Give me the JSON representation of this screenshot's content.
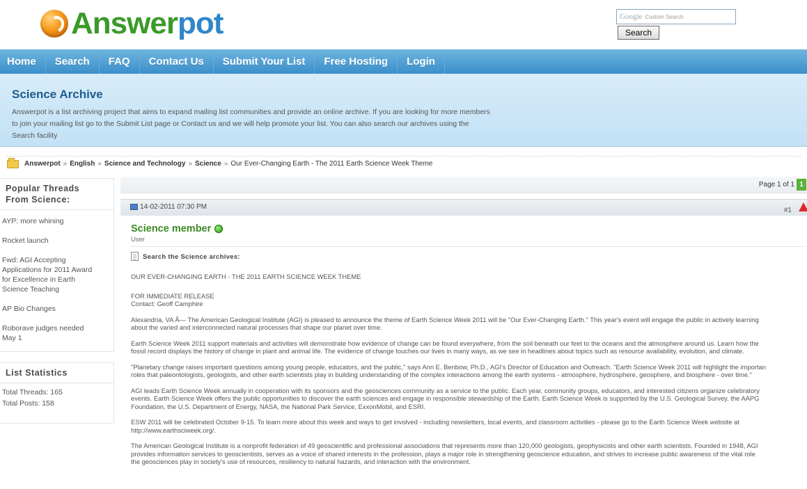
{
  "header": {
    "logo_part1": "Answer",
    "logo_part2": "pot",
    "search_brand": "Google",
    "search_placeholder": "Custom Search",
    "search_button": "Search"
  },
  "nav": [
    "Home",
    "Search",
    "FAQ",
    "Contact Us",
    "Submit Your List",
    "Free Hosting",
    "Login"
  ],
  "archive": {
    "title": "Science Archive",
    "description": "Answerpot is a list archiving project that aims to expand mailing list communities and provide an online archive. If you are looking for more members to join your mailing list go to the Submit List page or Contact us and we will help promote your list. You can also search our archives using the Search facility"
  },
  "breadcrumb": {
    "items": [
      "Answerpot",
      "English",
      "Science and Technology",
      "Science"
    ],
    "current": "Our Ever-Changing Earth - The 2011 Earth Science Week Theme",
    "separator": "»"
  },
  "sidebar": {
    "threads_title_line1": "Popular Threads",
    "threads_title_line2": "From Science:",
    "threads": [
      [
        "AYP: more whining"
      ],
      [
        "Rocket launch"
      ],
      [
        "Fwd: AGI Accepting",
        "Applications for 2011 Award",
        "for Excellence in Earth",
        "Science Teaching"
      ],
      [
        "AP Bio Changes"
      ],
      [
        "Roborave judges needed",
        "May 1"
      ]
    ],
    "stats_title": "List Statistics",
    "stats": [
      "Total Threads: 165",
      "Total Posts: 158"
    ]
  },
  "pagination": {
    "label": "Page 1 of 1",
    "current": "1"
  },
  "post": {
    "date": "14-02-2011 07:30 PM",
    "number": "#1",
    "author": "Science member",
    "role": "User",
    "search_label": "Search the Science archives:",
    "lines": [
      [
        "OUR EVER-CHANGING EARTH - THE 2011 EARTH SCIENCE WEEK THEME"
      ],
      [
        "FOR IMMEDIATE RELEASE",
        "Contact: Geoff Camphire"
      ],
      [
        "Alexandria, VA Â— The American Geological Institute (AGI) is pleased to announce the theme of Earth Science Week 2011 will be \"Our Ever-Changing Earth.\" This year's event will engage the public in actively learning",
        "about the varied and interconnected natural processes that shape our planet over time."
      ],
      [
        "Earth Science Week 2011 support materials and activities will demonstrate how evidence of change can be found everywhere, from the soil beneath our feet to the oceans and the atmosphere around us. Learn how the",
        "fossil record displays the history of change in plant and animal life. The evidence of change touches our lives in many ways, as we see in headlines about topics such as resource availability, evolution, and climate."
      ],
      [
        "\"Planetary change raises important questions among young people, educators, and the public,\" says Ann E. Benbow, Ph.D., AGI's Director of Education and Outreach. \"Earth Science Week 2011 will highlight the importan",
        "roles that paleontologists, geologists, and other earth scientists play in building understanding of the complex interactions among the earth systems - atmosphere, hydrosphere, geosphere, and biosphere - over time.\""
      ],
      [
        "AGI leads Earth Science Week annually in cooperation with its sponsors and the geosciences community as a service to the public. Each year, community groups, educators, and interested citizens organize celebratory",
        "events. Earth Science Week offers the public opportunities to discover the earth sciences and engage in responsible stewardship of the Earth. Earth Science Week is supported by the U.S. Geological Survey, the AAPG",
        "Foundation, the U.S. Department of Energy, NASA, the National Park Service, ExxonMobil, and ESRI."
      ],
      [
        "ESW 2011 will be celebrated October 9-15. To learn more about this week and ways to get involved - including newsletters, local events, and classroom activities - please go to the Earth Science Week website at",
        "http://www.earthsciweek.org/."
      ],
      [
        "The American Geological Institute is a nonprofit federation of 49 geoscientific and professional associations that represents more than 120,000 geologists, geophysicists and other earth scientists. Founded in 1948, AGI",
        "provides information services to geoscientists, serves as a voice of shared interests in the profession, plays a major role in strengthening geoscience education, and strives to increase public awareness of the vital role",
        "the geosciences play in society's use of resources, resiliency to natural hazards, and interaction with the environment."
      ]
    ]
  }
}
